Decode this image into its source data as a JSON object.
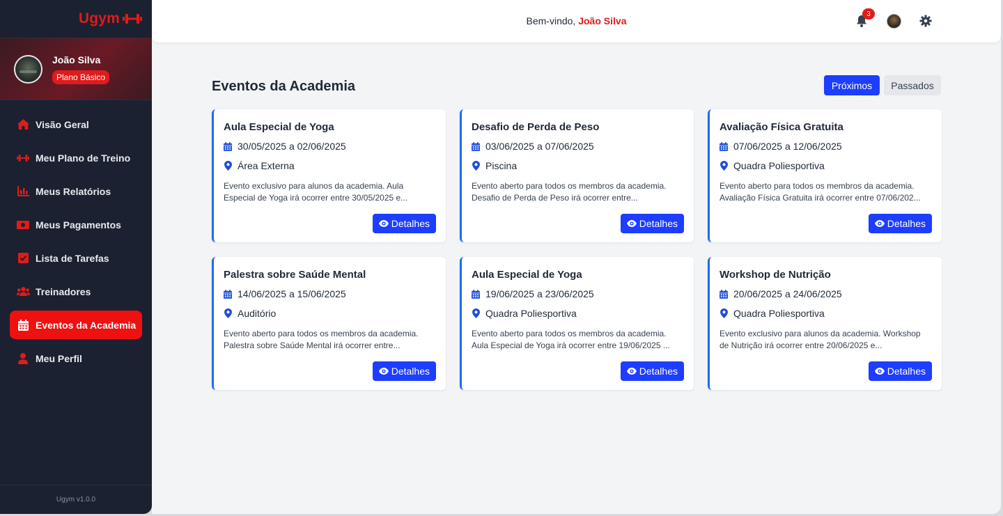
{
  "brand": {
    "name": "Ugym"
  },
  "user": {
    "name": "João Silva",
    "plan": "Plano Básico"
  },
  "nav": [
    {
      "label": "Visão Geral",
      "icon": "home-icon",
      "active": false
    },
    {
      "label": "Meu Plano de Treino",
      "icon": "dumbbell-icon",
      "active": false
    },
    {
      "label": "Meus Relatórios",
      "icon": "bar-chart-icon",
      "active": false
    },
    {
      "label": "Meus Pagamentos",
      "icon": "money-icon",
      "active": false
    },
    {
      "label": "Lista de Tarefas",
      "icon": "checkbox-icon",
      "active": false
    },
    {
      "label": "Treinadores",
      "icon": "users-icon",
      "active": false
    },
    {
      "label": "Eventos da Academia",
      "icon": "calendar-icon",
      "active": true
    },
    {
      "label": "Meu Perfil",
      "icon": "user-icon",
      "active": false
    }
  ],
  "version": "Ugym v1.0.0",
  "header": {
    "welcome_prefix": "Bem-vindo,",
    "welcome_name": "João Silva",
    "notifications_count": "3"
  },
  "page": {
    "title": "Eventos da Academia",
    "filters": {
      "upcoming": "Próximos",
      "past": "Passados"
    }
  },
  "events": [
    {
      "title": "Aula Especial de Yoga",
      "dates": "30/05/2025 a 02/06/2025",
      "location": "Área Externa",
      "description": "Evento exclusivo para alunos da academia. Aula Especial de Yoga irá ocorrer entre 30/05/2025 e...",
      "button": "Detalhes"
    },
    {
      "title": "Desafio de Perda de Peso",
      "dates": "03/06/2025 a 07/06/2025",
      "location": "Piscina",
      "description": "Evento aberto para todos os membros da academia. Desafio de Perda de Peso irá ocorrer entre...",
      "button": "Detalhes"
    },
    {
      "title": "Avaliação Física Gratuita",
      "dates": "07/06/2025 a 12/06/2025",
      "location": "Quadra Poliesportiva",
      "description": "Evento aberto para todos os membros da academia. Avaliação Física Gratuita irá ocorrer entre 07/06/202...",
      "button": "Detalhes"
    },
    {
      "title": "Palestra sobre Saúde Mental",
      "dates": "14/06/2025 a 15/06/2025",
      "location": "Auditório",
      "description": "Evento aberto para todos os membros da academia. Palestra sobre Saúde Mental irá ocorrer entre...",
      "button": "Detalhes"
    },
    {
      "title": "Aula Especial de Yoga",
      "dates": "19/06/2025 a 23/06/2025",
      "location": "Quadra Poliesportiva",
      "description": "Evento aberto para todos os membros da academia. Aula Especial de Yoga irá ocorrer entre 19/06/2025 ...",
      "button": "Detalhes"
    },
    {
      "title": "Workshop de Nutrição",
      "dates": "20/06/2025 a 24/06/2025",
      "location": "Quadra Poliesportiva",
      "description": "Evento exclusivo para alunos da academia. Workshop de Nutrição irá ocorrer entre 20/06/2025 e...",
      "button": "Detalhes"
    }
  ],
  "colors": {
    "brand_red": "#e11b1b",
    "accent_blue": "#1d3dff",
    "sidebar_bg": "#1b2130"
  }
}
